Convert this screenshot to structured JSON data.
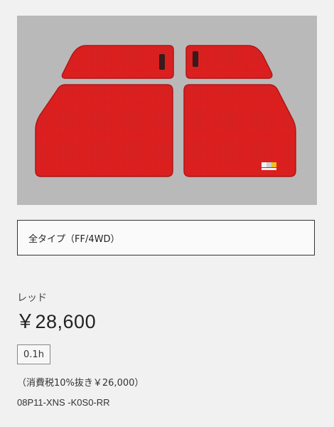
{
  "product": {
    "image_alt": "red floor mats",
    "variant_label": "全タイプ（FF/4WD）",
    "color_name": "レッド",
    "price": "￥28,600",
    "work_time": "0.1h",
    "tax_note": "（消費税10%抜き￥26,000）",
    "part_number": "08P11-XNS -K0S0-RR"
  },
  "colors": {
    "background": "#f1f1f1",
    "image_background": "#b9b9b9",
    "mat_red": "#dd2222",
    "mat_edge": "#b01616",
    "tag_dark": "#3a1a1a"
  },
  "icons": {
    "logo_badge": "mugen-badge-icon"
  }
}
